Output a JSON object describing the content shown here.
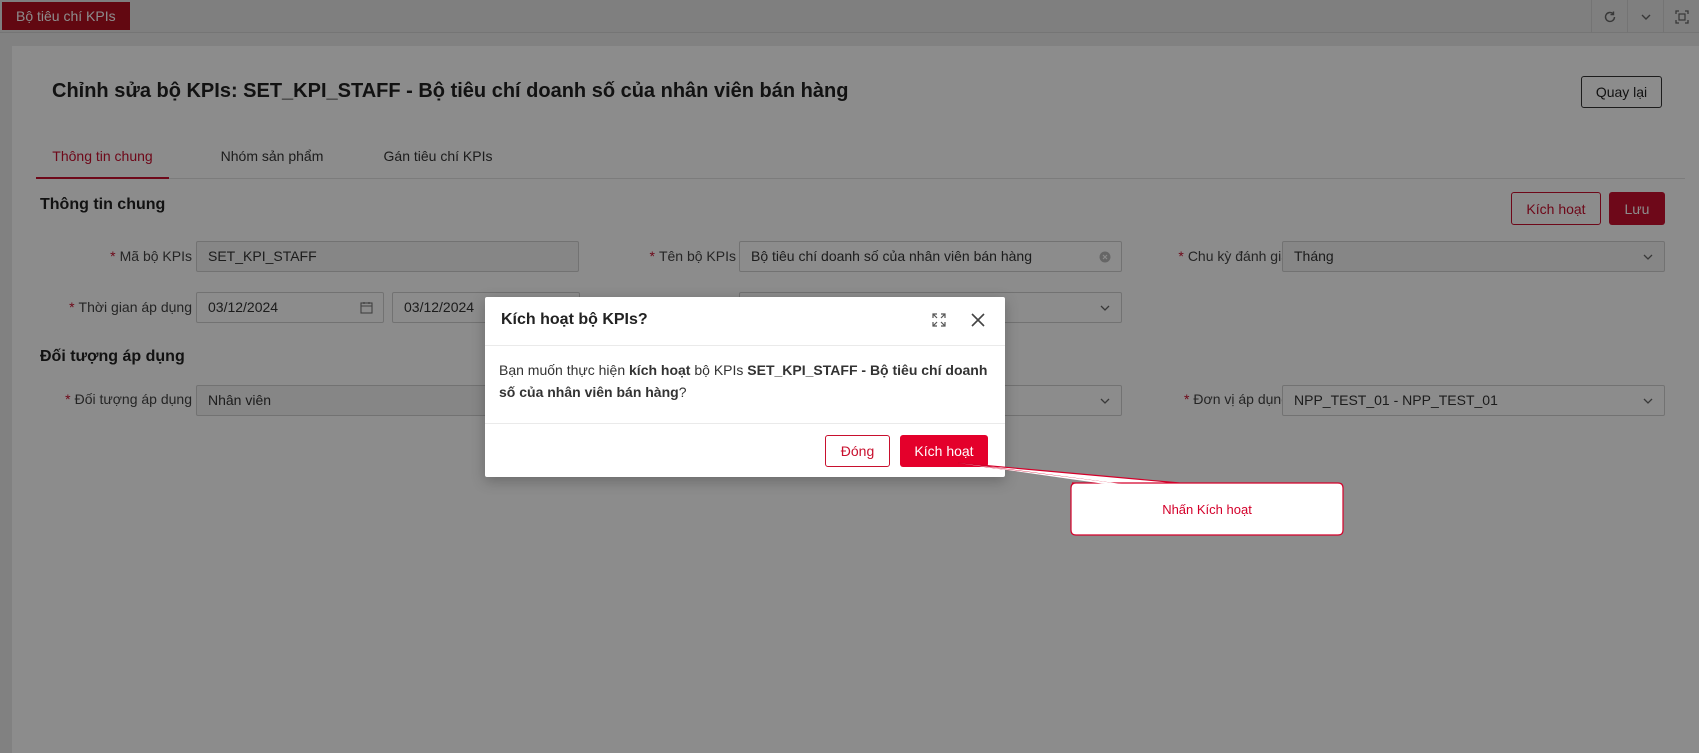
{
  "app": {
    "tab_label": "Bộ tiêu chí KPIs"
  },
  "topbar_icons": [
    "refresh-icon",
    "chevron-down-icon",
    "fullscreen-icon"
  ],
  "page": {
    "title": "Chỉnh sửa bộ KPIs: SET_KPI_STAFF - Bộ tiêu chí doanh số của nhân viên bán hàng",
    "back_label": "Quay lại"
  },
  "tabs": [
    {
      "label": "Thông tin chung",
      "active": true
    },
    {
      "label": "Nhóm sản phẩm",
      "active": false
    },
    {
      "label": "Gán tiêu chí KPIs",
      "active": false
    }
  ],
  "general": {
    "section_title": "Thông tin chung",
    "activate_label": "Kích hoạt",
    "save_label": "Lưu",
    "fields": {
      "code_label": "Mã bộ KPIs",
      "code_value": "SET_KPI_STAFF",
      "name_label": "Tên bộ KPIs",
      "name_value": "Bộ tiêu chí doanh số của nhân viên bán hàng",
      "cycle_label": "Chu kỳ đánh giá",
      "cycle_value": "Tháng",
      "period_label": "Thời gian áp dụng",
      "period_from": "03/12/2024",
      "period_to": "03/12/2024"
    }
  },
  "target": {
    "section_title": "Đối tượng áp dụng",
    "object_label": "Đối tượng áp dụng",
    "object_value": "Nhân viên",
    "unit_label": "Đơn vị áp dụng",
    "unit_value": "NPP_TEST_01 - NPP_TEST_01"
  },
  "modal": {
    "title": "Kích hoạt bộ KPIs?",
    "body_prefix": "Bạn muốn thực hiện ",
    "body_action": "kích hoạt",
    "body_middle": " bộ KPIs ",
    "body_target": "SET_KPI_STAFF - Bộ tiêu chí doanh số của nhân viên bán hàng",
    "body_suffix": "?",
    "close_label": "Đóng",
    "confirm_label": "Kích hoạt"
  },
  "callout": {
    "text": "Nhấn Kích hoạt"
  },
  "colors": {
    "brand": "#c8102e",
    "brand_dark": "#b30f1f",
    "confirm": "#e4002b"
  }
}
